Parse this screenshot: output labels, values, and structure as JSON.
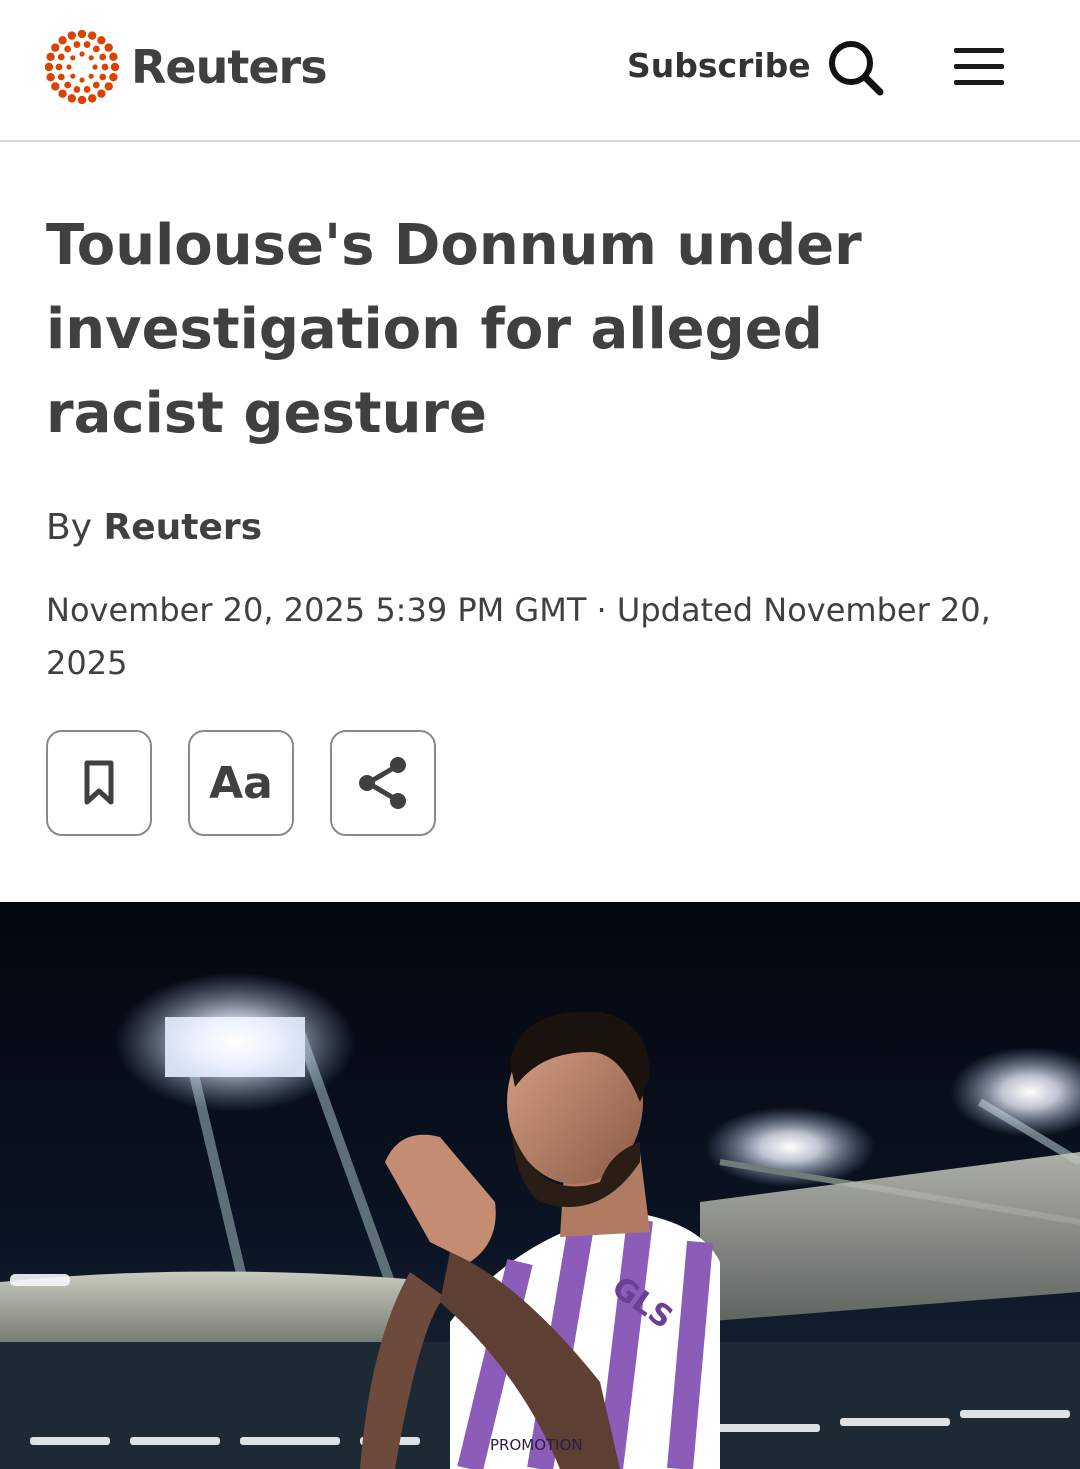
{
  "header": {
    "brand": "Reuters",
    "subscribe_label": "Subscribe"
  },
  "article": {
    "headline": "Toulouse's Donnum under investigation for alleged racist gesture",
    "byline_prefix": "By",
    "author": "Reuters",
    "dateline": "November 20, 2025 5:39 PM GMT · Updated November 20, 2025"
  },
  "tools": {
    "text_size_label": "Aa"
  },
  "hero": {
    "jersey_sponsor": "GLS",
    "shorts_text": "PROMOTION"
  },
  "icons": {
    "logo": "reuters-dots-logo",
    "search": "search-icon",
    "menu": "hamburger-menu-icon",
    "bookmark": "bookmark-icon",
    "share": "share-icon"
  },
  "colors": {
    "brand_orange": "#dc4300",
    "text": "#404040",
    "divider": "#d9d9d9"
  }
}
